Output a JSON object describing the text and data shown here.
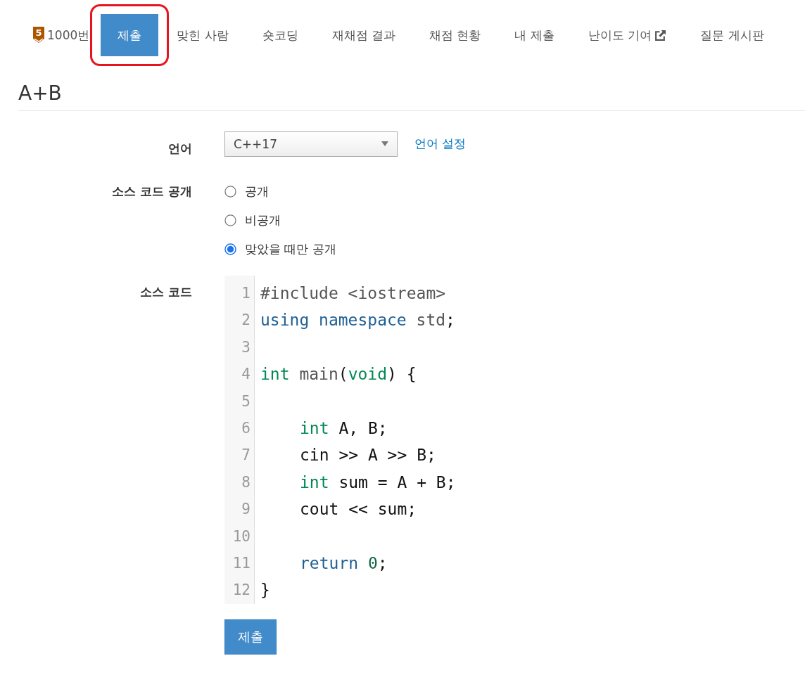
{
  "problem_badge": {
    "tier": "5",
    "label": "1000번"
  },
  "tabs": [
    {
      "label": "제출",
      "selected": true,
      "circled": true
    },
    {
      "label": "맞힌 사람",
      "selected": false,
      "circled": false
    },
    {
      "label": "숏코딩",
      "selected": false,
      "circled": false
    },
    {
      "label": "재채점 결과",
      "selected": false,
      "circled": false
    },
    {
      "label": "채점 현황",
      "selected": false,
      "circled": false
    },
    {
      "label": "내 제출",
      "selected": false,
      "circled": false
    },
    {
      "label": "난이도 기여",
      "selected": false,
      "circled": false,
      "external": true
    },
    {
      "label": "질문 게시판",
      "selected": false,
      "circled": false
    }
  ],
  "title": "A+B",
  "language": {
    "label": "언어",
    "value": "C++17",
    "settings_link": "언어 설정"
  },
  "visibility": {
    "label": "소스 코드 공개",
    "options": [
      {
        "label": "공개",
        "selected": false
      },
      {
        "label": "비공개",
        "selected": false
      },
      {
        "label": "맞았을 때만 공개",
        "selected": true
      }
    ]
  },
  "source": {
    "label": "소스 코드",
    "lines": [
      {
        "number": "1",
        "indented": false,
        "tokens": [
          {
            "t": "#include <iostream>",
            "kind": "meta"
          }
        ]
      },
      {
        "number": "2",
        "indented": false,
        "tokens": [
          {
            "t": "using namespace",
            "kind": "keyword"
          },
          {
            "t": " std",
            "kind": "def"
          },
          {
            "t": ";",
            "kind": "plain"
          }
        ]
      },
      {
        "number": "3"
      },
      {
        "number": "4",
        "indented": false,
        "tokens": [
          {
            "t": "int",
            "kind": "type"
          },
          {
            "t": " main",
            "kind": "def"
          },
          {
            "t": "(",
            "kind": "plain"
          },
          {
            "t": "void",
            "kind": "type"
          },
          {
            "t": ") {",
            "kind": "plain"
          }
        ]
      },
      {
        "number": "5"
      },
      {
        "number": "6",
        "indented": true,
        "tokens": [
          {
            "t": "int",
            "kind": "type"
          },
          {
            "t": " A, B;",
            "kind": "plain"
          }
        ]
      },
      {
        "number": "7",
        "indented": true,
        "tokens": [
          {
            "t": "cin >> A >> B;",
            "kind": "plain"
          }
        ]
      },
      {
        "number": "8",
        "indented": true,
        "tokens": [
          {
            "t": "int",
            "kind": "type"
          },
          {
            "t": " sum = A + B;",
            "kind": "plain"
          }
        ]
      },
      {
        "number": "9",
        "indented": true,
        "tokens": [
          {
            "t": "cout << sum;",
            "kind": "plain"
          }
        ]
      },
      {
        "number": "10"
      },
      {
        "number": "11",
        "indented": true,
        "tokens": [
          {
            "t": "return ",
            "kind": "keyword"
          },
          {
            "t": "0",
            "kind": "number"
          },
          {
            "t": ";",
            "kind": "plain"
          }
        ]
      },
      {
        "number": "12",
        "indented": false,
        "tokens": [
          {
            "t": "}",
            "kind": "plain"
          }
        ]
      }
    ]
  },
  "submit_button": "제출"
}
